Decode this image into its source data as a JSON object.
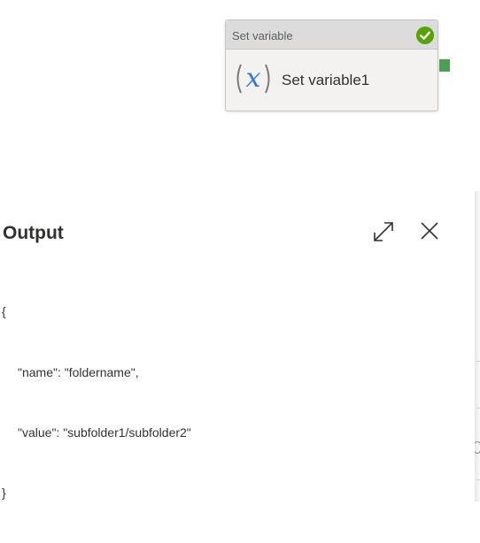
{
  "activity": {
    "type_label": "Set variable",
    "name": "Set variable1",
    "status": "succeeded",
    "status_color": "#57a300",
    "icon": "variable-x-icon",
    "port_color": "#4b9f52"
  },
  "output_panel": {
    "title": "Output",
    "expand_icon": "expand-icon",
    "close_icon": "close-icon",
    "json_lines": {
      "open": "{",
      "name_line": "\"name\": \"foldername\",",
      "value_line": "\"value\": \"subfolder1/subfolder2\"",
      "close": "}"
    }
  }
}
